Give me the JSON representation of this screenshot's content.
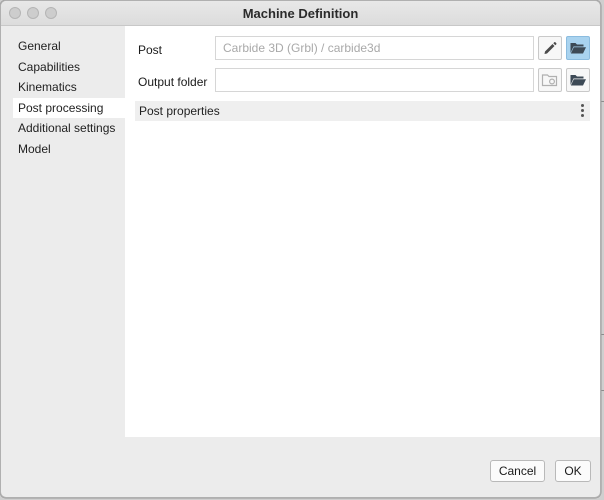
{
  "window": {
    "title": "Machine Definition"
  },
  "sidebar": {
    "items": [
      {
        "label": "General"
      },
      {
        "label": "Capabilities"
      },
      {
        "label": "Kinematics"
      },
      {
        "label": "Post processing",
        "selected": true
      },
      {
        "label": "Additional settings"
      },
      {
        "label": "Model"
      }
    ]
  },
  "post": {
    "label": "Post",
    "value": "Carbide 3D (Grbl) / carbide3d",
    "edit_icon": "pencil-icon",
    "browse_icon": "folder-open-icon"
  },
  "output_folder": {
    "label": "Output folder",
    "value": "",
    "reveal_icon": "folder-reveal-icon",
    "browse_icon": "folder-open-icon"
  },
  "post_properties": {
    "label": "Post properties",
    "menu_icon": "kebab-menu-icon"
  },
  "footer": {
    "cancel_label": "Cancel",
    "ok_label": "OK"
  },
  "colors": {
    "selected_button": "#a9d3ef",
    "panel_bg": "#ffffff",
    "window_bg": "#ececec"
  }
}
